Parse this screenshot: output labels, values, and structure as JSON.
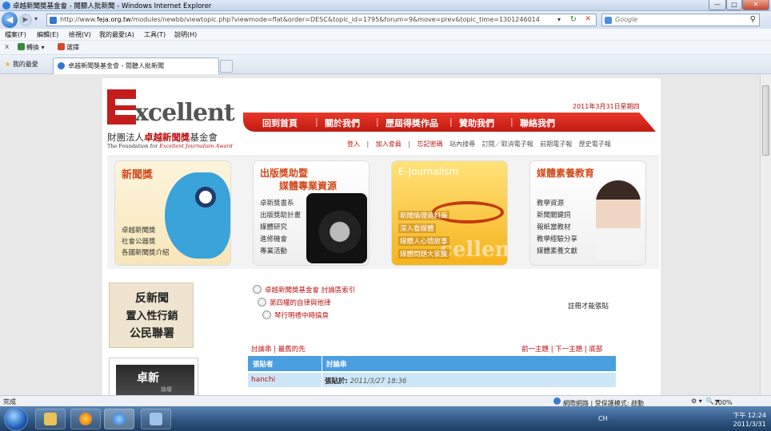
{
  "window": {
    "title": "卓越新聞獎基金會 - 閱聽人批新聞 - Windows Internet Explorer",
    "min": "—",
    "max": "□",
    "close": "✕"
  },
  "address": {
    "url_prefix": "http://www.",
    "url_domain": "feja.org.tw",
    "url_rest": "/modules/newbb/viewtopic.php?viewmode=flat&order=DESC&topic_id=1795&forum=9&move=prev&topic_time=1301246014",
    "search_placeholder": "Google",
    "back": "◀",
    "forward": "▶",
    "refresh": "↻",
    "stop": "✕",
    "go": "▾"
  },
  "menu": [
    "檔案(F)",
    "編輯(E)",
    "檢視(V)",
    "我的最愛(A)",
    "工具(T)",
    "說明(H)"
  ],
  "toolbar": {
    "convert": "轉換",
    "select": "選擇",
    "close": "x"
  },
  "favorites": {
    "label": "我的最愛",
    "tab_title": "卓越新聞獎基金會 - 閱聽人批新聞"
  },
  "header": {
    "logo_text": "xcellent",
    "logo_cn_prefix": "財團法人",
    "logo_cn_bold": "卓越新聞獎",
    "logo_cn_suffix": "基金會",
    "logo_en_prefix": "The Foundation for ",
    "logo_en_italic": "Excellent Journalism Award",
    "date": "2011年3月31日星期四",
    "nav": [
      "回到首頁",
      "關於我們",
      "歷屆得獎作品",
      "贊助我們",
      "聯絡我們"
    ],
    "nav_sep": "|",
    "sublinks": [
      "登入",
      "|",
      "加入會員",
      "|",
      "忘記密碼",
      "站內搜尋",
      "訂閱／取消電子報",
      "前期電子報",
      "歷史電子報"
    ]
  },
  "banner": {
    "cards": [
      {
        "title": "新聞獎",
        "lines": [
          "卓越新聞獎",
          "社會公器獎",
          "各國新聞獎介紹"
        ]
      },
      {
        "title": "出版獎助暨",
        "title2": "媒體專業資源",
        "lines": [
          "卓新獎書系",
          "出版獎助計畫",
          "媒體研究",
          "進修機會",
          "專業活動"
        ]
      },
      {
        "title": "E-Journalism",
        "ghost": "cellent",
        "lines": [
          "新聞倫理資料庫",
          "深入看媒體",
          "媒體人心情故事",
          "媒體問題大家談"
        ]
      },
      {
        "title": "媒體素養教育",
        "lines": [
          "教學資源",
          "新聞關鍵詞",
          "報紙當教材",
          "教學經驗分享",
          "媒體素養文獻"
        ]
      }
    ]
  },
  "sidebar": {
    "ad1": [
      "反新聞",
      "置入性行銷",
      "公民聯署"
    ],
    "ad2_title": "卓新",
    "ad2_sub": "論壇"
  },
  "forum": {
    "breadcrumb": [
      "卓越新聞獎基金會 討論區索引",
      "第四權的自律與他律",
      "琴行明禮中時搞臭"
    ],
    "register_note": "註冊才能張貼",
    "thread_tabs": "討論串 | 最舊的先",
    "thread_nav": "前一主題 | 下一主題 | 底部",
    "col_author": "張貼者",
    "col_thread": "討論串",
    "author": "hanchi",
    "posted_label": "張貼於:",
    "posted_time": "2011/3/27 18:36"
  },
  "status": {
    "left": "完成",
    "zone": "網際網路 | 受保護模式: 啟動",
    "zoom": "100%"
  },
  "taskbar": {
    "ime": "CH",
    "time": "下午 12:24",
    "date": "2011/3/31"
  },
  "colors": {
    "brand_red": "#c41d1d",
    "nav_red": "#d42a1e",
    "table_blue": "#4a9fe0",
    "row_blue": "#cde6f8"
  }
}
